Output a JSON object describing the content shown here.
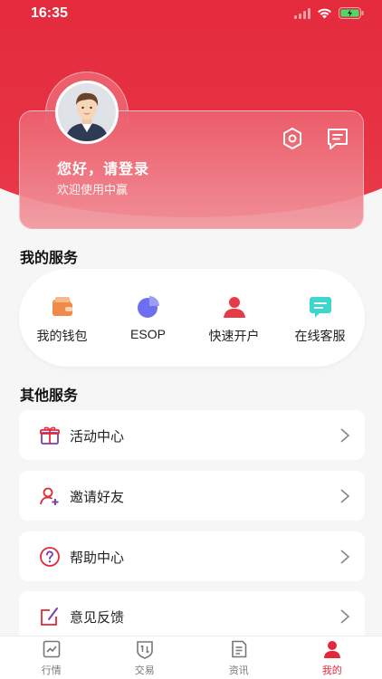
{
  "status_bar": {
    "time": "16:35"
  },
  "profile": {
    "greeting": "您好，请登录",
    "welcome": "欢迎使用中赢",
    "settings_icon": "gear-icon",
    "message_icon": "message-icon"
  },
  "my_services": {
    "title": "我的服务",
    "items": [
      {
        "label": "我的钱包",
        "icon": "wallet-icon"
      },
      {
        "label": "ESOP",
        "icon": "pie-chart-icon"
      },
      {
        "label": "快速开户",
        "icon": "user-icon"
      },
      {
        "label": "在线客服",
        "icon": "chat-icon"
      }
    ]
  },
  "other_services": {
    "title": "其他服务",
    "items": [
      {
        "label": "活动中心",
        "icon": "gift-icon"
      },
      {
        "label": "邀请好友",
        "icon": "add-user-icon"
      },
      {
        "label": "帮助中心",
        "icon": "help-icon"
      },
      {
        "label": "意见反馈",
        "icon": "feedback-icon"
      }
    ]
  },
  "tabbar": {
    "tabs": [
      {
        "label": "行情",
        "icon": "chart-icon",
        "active": false
      },
      {
        "label": "交易",
        "icon": "trade-icon",
        "active": false
      },
      {
        "label": "资讯",
        "icon": "news-icon",
        "active": false
      },
      {
        "label": "我的",
        "icon": "profile-icon",
        "active": true
      }
    ]
  },
  "colors": {
    "brand": "#e3283a",
    "background": "#f6f6f7"
  }
}
